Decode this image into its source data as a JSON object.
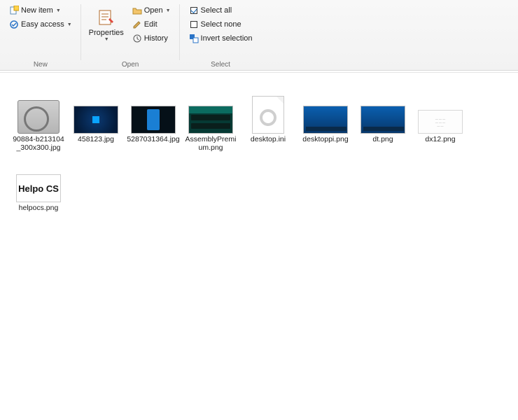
{
  "ribbon": {
    "new": {
      "new_item": "New item",
      "easy_access": "Easy access",
      "group_label": "New"
    },
    "open": {
      "properties": "Properties",
      "open": "Open",
      "edit": "Edit",
      "history": "History",
      "group_label": "Open"
    },
    "select": {
      "select_all": "Select all",
      "select_none": "Select none",
      "invert": "Invert selection",
      "group_label": "Select"
    }
  },
  "files": [
    {
      "name": "90884-b213104_300x300.jpg"
    },
    {
      "name": "458123.jpg"
    },
    {
      "name": "5287031364.jpg"
    },
    {
      "name": "AssemblyPremium.png"
    },
    {
      "name": "desktop.ini"
    },
    {
      "name": "desktoppi.png"
    },
    {
      "name": "dt.png"
    },
    {
      "name": "dx12.png"
    },
    {
      "name": "helpocs.png"
    }
  ],
  "helpo_text": "Helpo CS"
}
